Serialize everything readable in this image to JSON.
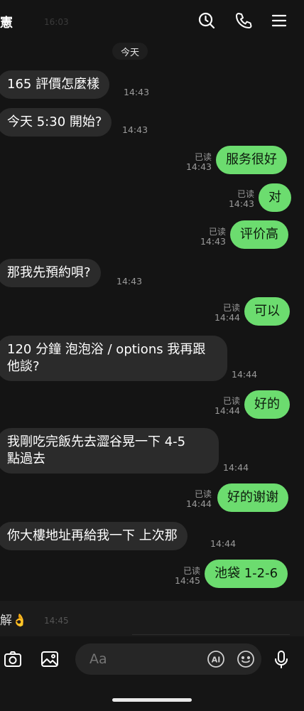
{
  "header": {
    "title": "憲",
    "time": "16:03"
  },
  "date_label": "今天",
  "messages": [
    {
      "text": "165 評價怎麼樣",
      "time": "14:43"
    },
    {
      "text": "今天 5:30 開始?",
      "time": "14:43"
    },
    {
      "text": "服务很好",
      "read": "已读",
      "time": "14:43"
    },
    {
      "text": "对",
      "read": "已读",
      "time": "14:43"
    },
    {
      "text": "评价高",
      "read": "已读",
      "time": "14:43"
    },
    {
      "text": "那我先預約唄?",
      "time": "14:43"
    },
    {
      "text": "可以",
      "read": "已读",
      "time": "14:44"
    },
    {
      "text": "120 分鐘 泡泡浴 / options 我再跟\n他談?",
      "time": "14:44"
    },
    {
      "text": "好的",
      "read": "已读",
      "time": "14:44"
    },
    {
      "text": "我剛吃完飯先去澀谷晃一下 4-5\n點過去",
      "time": "14:44"
    },
    {
      "text": "好的谢谢",
      "read": "已读",
      "time": "14:44"
    },
    {
      "text": "你大樓地址再給我一下 上次那",
      "time": "14:44"
    },
    {
      "text": "池袋 1-2-6",
      "read": "已读",
      "time": "14:45"
    }
  ],
  "reply_preview": {
    "text": "解👌",
    "time": "14:45"
  },
  "input": {
    "placeholder": "Aa"
  },
  "icons": [
    "search-icon",
    "phone-icon",
    "menu-icon",
    "camera-icon",
    "image-icon",
    "ai-icon",
    "emoji-icon",
    "mic-icon"
  ]
}
